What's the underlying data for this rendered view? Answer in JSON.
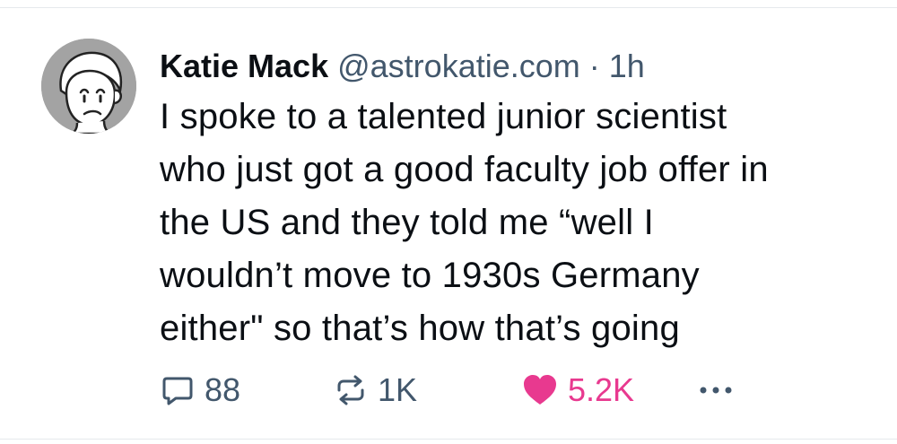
{
  "post": {
    "author": {
      "display_name": "Katie Mack",
      "handle": "@astrokatie.com",
      "separator": "·",
      "time": "1h"
    },
    "text_lines": [
      "I spoke to a talented junior scientist",
      "who just got a good faculty job offer in",
      "the US and they told me “well I",
      "wouldn’t move to 1930s Germany",
      "either\" so that’s how that’s going"
    ],
    "stats": {
      "replies": "88",
      "reposts": "1K",
      "likes": "5.2K"
    },
    "icons": {
      "reply": "speech-bubble-icon",
      "repost": "repost-arrows-icon",
      "like": "heart-icon",
      "more": "ellipsis-icon"
    },
    "colors": {
      "text": "#0b0f14",
      "muted": "#42576c",
      "like": "#e8398f",
      "avatar_bg": "#a3a3a3"
    },
    "liked": true
  }
}
